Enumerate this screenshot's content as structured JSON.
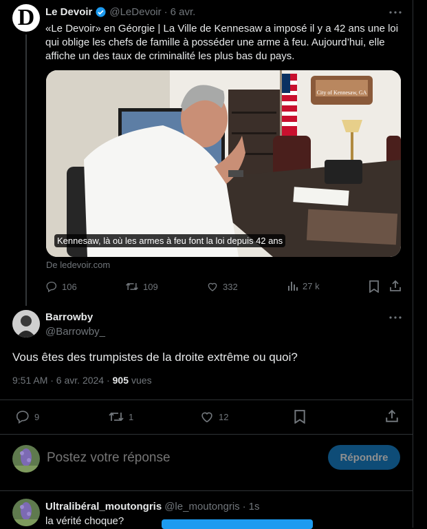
{
  "quoted_tweet": {
    "author_name": "Le Devoir",
    "handle": "@LeDevoir",
    "time": "6 avr.",
    "text": "«Le Devoir» en Géorgie | La Ville de Kennesaw a imposé il y a 42 ans une loi qui oblige les chefs de famille à posséder une arme à feu. Aujourd’hui, elle affiche un des taux de criminalité les plus bas du pays.",
    "card_caption": "Kennesaw, là où les armes à feu font la loi depuis 42 ans",
    "sign_text": "City of Kennesaw, GA",
    "source": "De ledevoir.com",
    "stats": {
      "replies": "106",
      "retweets": "109",
      "likes": "332",
      "views": "27 k"
    }
  },
  "main_tweet": {
    "author_name": "Barrowby",
    "handle": "@Barrowby_",
    "text": "Vous êtes des trumpistes de la droite extrême ou quoi?",
    "date": "9:51 AM · 6 avr. 2024 ·",
    "views_count": "905",
    "views_label": "vues",
    "stats": {
      "replies": "9",
      "retweets": "1",
      "likes": "12"
    }
  },
  "reply_box": {
    "placeholder": "Postez votre réponse",
    "button": "Répondre"
  },
  "reply_tweet": {
    "author_name": "Ultralibéral_moutongris",
    "handle": "@le_moutongris",
    "time": "1s",
    "text": "la vérité choque?"
  },
  "colors": {
    "accent": "#1d9bf0",
    "verified": "#1d9bf0",
    "background": "#000000",
    "border": "#2f3336",
    "muted": "#71767b"
  },
  "icons": [
    "more-icon",
    "verified-icon",
    "reply-icon",
    "retweet-icon",
    "like-icon",
    "views-icon",
    "bookmark-icon",
    "share-icon"
  ]
}
